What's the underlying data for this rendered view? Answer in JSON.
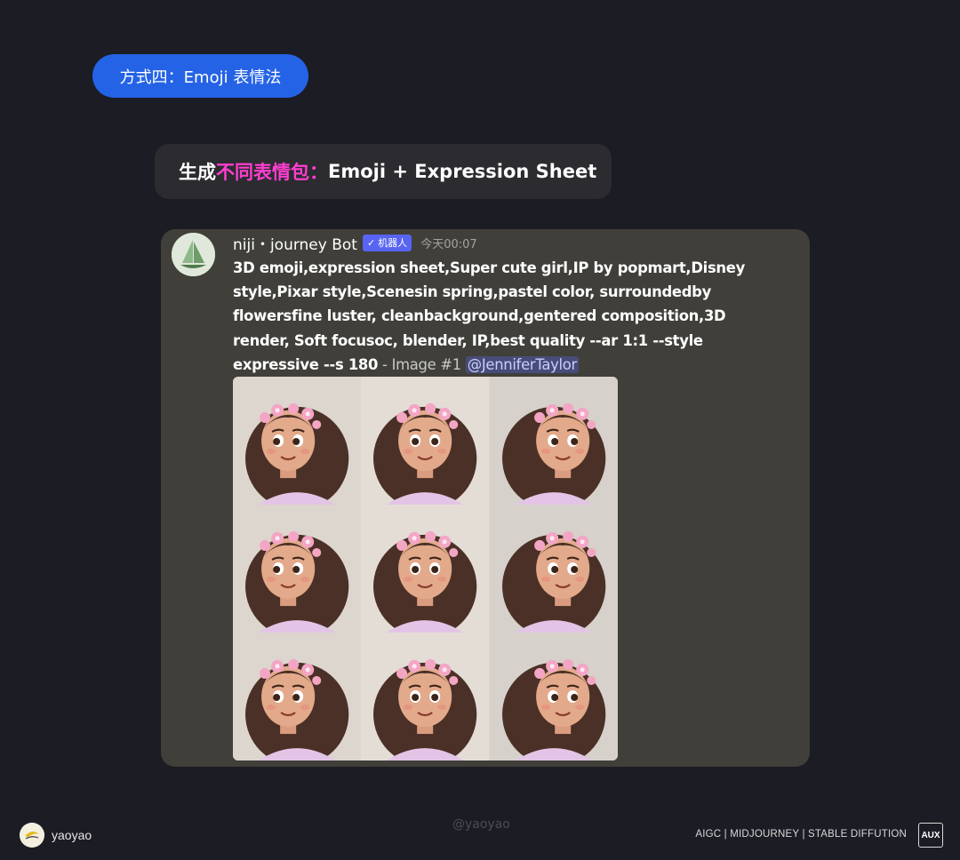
{
  "section_pill": "方式四：Emoji 表情法",
  "heading": {
    "prefix": "生成",
    "accent": "不同表情包：",
    "suffix": "Emoji + Expression Sheet"
  },
  "message": {
    "bot_name": "niji・journey Bot",
    "badge_check": "✓",
    "badge_label": "机器人",
    "timestamp": "今天00:07",
    "prompt_text": "3D emoji,expression sheet,Super cute girl,IP by popmart,Disney style,Pixar style,Scenesin spring,pastel color, surroundedby flowersfine luster, cleanbackground,gentered composition,3D render, Soft focusoc, blender, IP,best quality --ar 1:1 --style expressive --s 180",
    "prompt_suffix": " - Image #1 ",
    "mention": "@JenniferTaylor",
    "grid_tiles": 9
  },
  "footer": {
    "author": "yaoyao",
    "watermark": "@yaoyao",
    "tags": "AIGC | MIDJOURNEY | STABLE DIFFUTION",
    "badge": "AUX"
  },
  "colors": {
    "background": "#1c1c24",
    "pill": "#2563e6",
    "accent": "#ff3ecf",
    "card": "#403f39",
    "discord_badge": "#5865f2"
  }
}
